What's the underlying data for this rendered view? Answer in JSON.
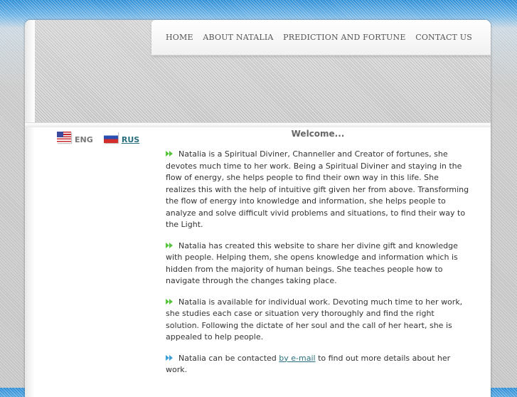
{
  "nav": {
    "items": [
      {
        "label": "HOME"
      },
      {
        "label": "ABOUT NATALIA"
      },
      {
        "label": "PREDICTION AND FORTUNE"
      },
      {
        "label": "CONTACT US"
      }
    ]
  },
  "languages": {
    "eng_label": "ENG",
    "rus_label": "RUS",
    "eng_icon": "us-flag-icon",
    "rus_icon": "ru-flag-icon"
  },
  "main": {
    "welcome": "Welcome...",
    "paragraphs": [
      "Natalia is a Spiritual Diviner, Channeller and Creator of fortunes, she devotes much time to her work. Being a Spiritual Diviner and staying in the flow of energy, she helps people to find their own way in this life. She realizes this with the help of intuitive gift given her from above. Transforming the flow of energy into knowledge and information, she helps people to analyze and solve difficult vivid problems and situations, to find their way to the Light.",
      "Natalia has created this website to share her divine gift and knowledge with people. Helping them, she opens knowledge and information which is hidden from the majority of human beings. She teaches people how to navigate through the changes taking place.",
      "Natalia is available for individual work. Devoting much time to her work, she studies each case or situation very thoroughly and find the right solution. Following the dictate of her soul and the call of her heart, she is appealed to help people."
    ],
    "contact_prefix": "Natalia can be contacted ",
    "contact_link": "by e-mail",
    "contact_suffix": " to find out more details about her work.",
    "bullet_colors": {
      "green": "#56c43e",
      "blue": "#3d9fd6"
    }
  }
}
